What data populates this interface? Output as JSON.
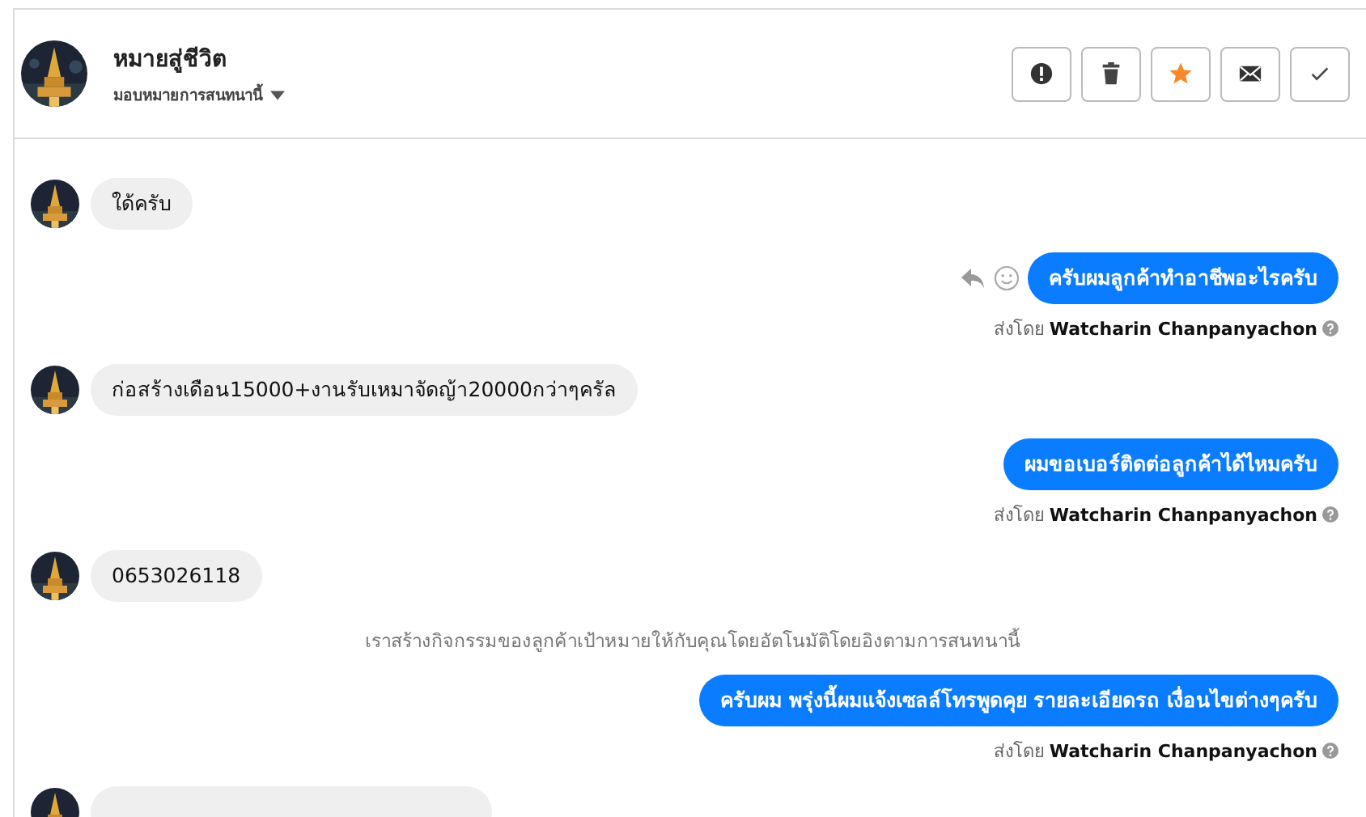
{
  "header": {
    "title": "หมายสู่ชีวิต",
    "subtitle": "มอบหมายการสนทนานี้",
    "buttons": [
      {
        "kind": "alert",
        "on": false
      },
      {
        "kind": "trash",
        "on": false
      },
      {
        "kind": "star",
        "on": true
      },
      {
        "kind": "mail",
        "on": false
      },
      {
        "kind": "check",
        "on": false
      }
    ]
  },
  "messages": [
    {
      "kind": "incoming",
      "text": "ใด้ครับ"
    },
    {
      "kind": "outgoing",
      "text": "ครับผมลูกค้าทำอาชีพอะไรครับ",
      "hover_actions": true
    },
    {
      "kind": "sent_by",
      "prefix": "ส่งโดย",
      "name": "Watcharin Chanpanyachon"
    },
    {
      "kind": "incoming",
      "text": "ก่อสร้างเดือน15000+งานรับเหมาจัดญ้า20000กว่าๆครัล"
    },
    {
      "kind": "outgoing",
      "text": "ผมขอเบอร์ติดต่อลูกค้าได้ไหมครับ",
      "hover_actions": false
    },
    {
      "kind": "sent_by",
      "prefix": "ส่งโดย",
      "name": "Watcharin Chanpanyachon"
    },
    {
      "kind": "incoming",
      "text": "0653026118"
    },
    {
      "kind": "note",
      "text": "เราสร้างกิจกรรมของลูกค้าเป้าหมายให้กับคุณโดยอัตโนมัติโดยอิงตามการสนทนานี้"
    },
    {
      "kind": "outgoing",
      "text": "ครับผม พรุ่งนี้ผมแจ้งเซลล์โทรพูดคุย รายละเอียดรถ เงื่อนไขต่างๆครับ",
      "hover_actions": false
    },
    {
      "kind": "sent_by",
      "prefix": "ส่งโดย",
      "name": "Watcharin Chanpanyachon"
    },
    {
      "kind": "incoming"
    }
  ]
}
